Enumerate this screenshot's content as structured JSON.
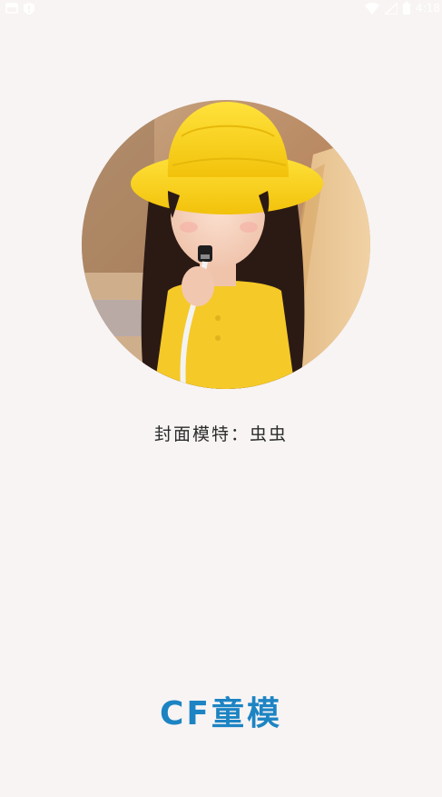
{
  "status_bar": {
    "time": "4:18",
    "left_icons": [
      "notification-icon",
      "shield-icon"
    ],
    "right_icons": [
      "wifi-icon",
      "signal-icon",
      "battery-icon"
    ]
  },
  "splash": {
    "cover_image": "portrait-image",
    "caption": "封面模特：虫虫",
    "brand": "CF童模",
    "brand_color": "#1d84c3",
    "background": "#f8f4f4"
  }
}
